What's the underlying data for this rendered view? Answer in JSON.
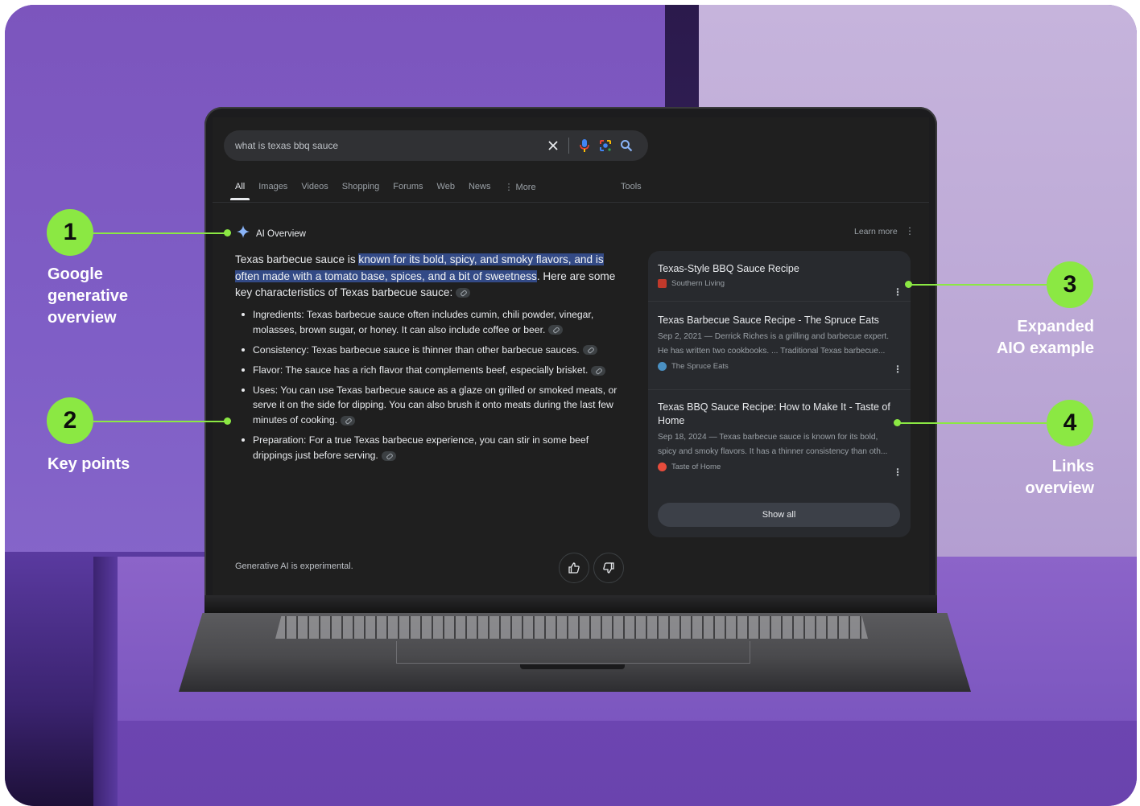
{
  "search": {
    "query": "what is texas bbq sauce"
  },
  "tabs": [
    "All",
    "Images",
    "Videos",
    "Shopping",
    "Forums",
    "Web",
    "News",
    "More"
  ],
  "tools_label": "Tools",
  "ai_overview": {
    "title": "AI Overview",
    "learn_more": "Learn more",
    "intro_before": "Texas barbecue sauce is ",
    "intro_highlight": "known for its bold, spicy, and smoky flavors, and is often made with a tomato base, spices, and a bit of sweetness",
    "intro_after": ". Here are some key characteristics of Texas barbecue sauce:",
    "bullets": [
      "Ingredients: Texas barbecue sauce often includes cumin, chili powder, vinegar, molasses, brown sugar, or honey. It can also include coffee or beer.",
      "Consistency: Texas barbecue sauce is thinner than other barbecue sauces.",
      "Flavor: The sauce has a rich flavor that complements beef, especially brisket.",
      "Uses: You can use Texas barbecue sauce as a glaze on grilled or smoked meats, or serve it on the side for dipping. You can also brush it onto meats during the last few minutes of cooking.",
      "Preparation: For a true Texas barbecue experience, you can stir in some beef drippings just before serving."
    ],
    "disclaimer": "Generative AI is experimental."
  },
  "sources": [
    {
      "title": "Texas-Style BBQ Sauce Recipe",
      "snippet_1": "",
      "snippet_2": "",
      "site": "Southern Living",
      "favicon_color": "#c0392b"
    },
    {
      "title": "Texas Barbecue Sauce Recipe - The Spruce Eats",
      "snippet_1": "Sep 2, 2021 — Derrick Riches is a grilling and barbecue expert.",
      "snippet_2": "He has written two cookbooks. ... Traditional Texas barbecue...",
      "site": "The Spruce Eats",
      "favicon_color": "#4a90c2"
    },
    {
      "title": "Texas BBQ Sauce Recipe: How to Make It - Taste of Home",
      "snippet_1": "Sep 18, 2024 — Texas barbecue sauce is known for its bold,",
      "snippet_2": "spicy and smoky flavors. It has a thinner consistency than oth...",
      "site": "Taste of Home",
      "favicon_color": "#e74c3c"
    }
  ],
  "show_all": "Show all",
  "annotations": [
    {
      "number": "1",
      "caption": "Google\ngenerative\noverview"
    },
    {
      "number": "2",
      "caption": "Key points"
    },
    {
      "number": "3",
      "caption": "Expanded\nAIO example"
    },
    {
      "number": "4",
      "caption": "Links\noverview"
    }
  ],
  "colors": {
    "accent_green": "#8be843",
    "highlight_blue": "#334a86",
    "screen_bg": "#1f1f1f",
    "purple_bg": "#7b55bf"
  },
  "icons": [
    "clear-icon",
    "mic-icon",
    "lens-icon",
    "search-icon",
    "sparkle-icon",
    "thumbs-up-icon",
    "thumbs-down-icon",
    "kebab-icon",
    "link-icon"
  ]
}
